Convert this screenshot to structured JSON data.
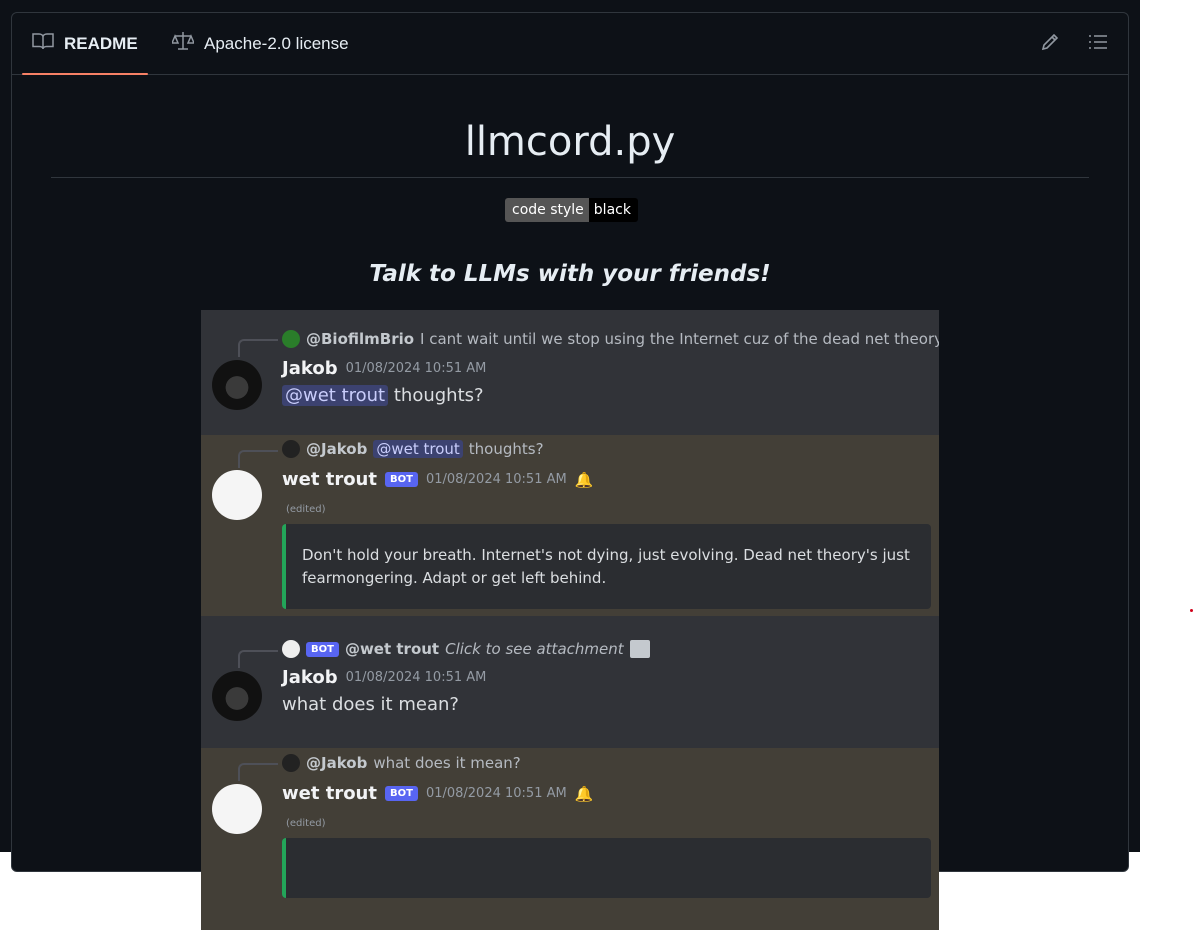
{
  "tabs": {
    "readme_label": "README",
    "license_label": "Apache-2.0 license"
  },
  "readme": {
    "title": "llmcord.py",
    "badge": {
      "left": "code style",
      "right": "black"
    },
    "tagline": "Talk to LLMs with your friends!"
  },
  "discord": {
    "messages": [
      {
        "reply_name": "@BiofilmBrio",
        "reply_text": "I cant wait until we stop using the Internet cuz of the dead net theory",
        "author": "Jakob",
        "timestamp": "01/08/2024 10:51 AM",
        "mention": "@wet trout",
        "body": "thoughts?"
      },
      {
        "reply_name": "@Jakob",
        "reply_mention": "@wet trout",
        "reply_text": "thoughts?",
        "author": "wet trout",
        "bot_tag": "BOT",
        "timestamp": "01/08/2024 10:51 AM",
        "edited": "(edited)",
        "embed": "Don't hold your breath. Internet's not dying, just evolving. Dead net theory's just fearmongering. Adapt or get left behind."
      },
      {
        "reply_bot_tag": "BOT",
        "reply_name": "@wet trout",
        "reply_text": "Click to see attachment",
        "author": "Jakob",
        "timestamp": "01/08/2024 10:51 AM",
        "body": "what does it mean?"
      },
      {
        "reply_name": "@Jakob",
        "reply_text": "what does it mean?",
        "author": "wet trout",
        "bot_tag": "BOT",
        "timestamp": "01/08/2024 10:51 AM",
        "edited": "(edited)"
      }
    ]
  },
  "icons": [
    "book-icon",
    "law-icon",
    "pencil-icon",
    "list-icon",
    "image-icon",
    "bell-icon"
  ],
  "colors": {
    "background": "#0d1117",
    "tab_underline": "#f78166",
    "discord_bg": "#313338",
    "discord_highlight": "#433f37",
    "bot_tag": "#5865f2",
    "embed_border": "#23a559"
  }
}
